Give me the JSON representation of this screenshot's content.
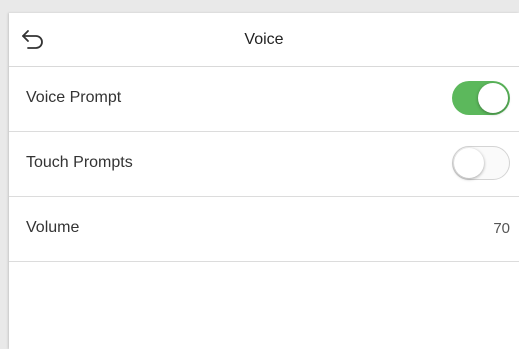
{
  "header": {
    "title": "Voice"
  },
  "settings": {
    "voice_prompt": {
      "label": "Voice Prompt",
      "enabled": true
    },
    "touch_prompts": {
      "label": "Touch Prompts",
      "enabled": false
    },
    "volume": {
      "label": "Volume",
      "value": "70"
    }
  },
  "colors": {
    "toggle_on": "#5cb85c",
    "toggle_off": "#fafafa"
  },
  "icons": {
    "back": "back-arrow-icon"
  }
}
